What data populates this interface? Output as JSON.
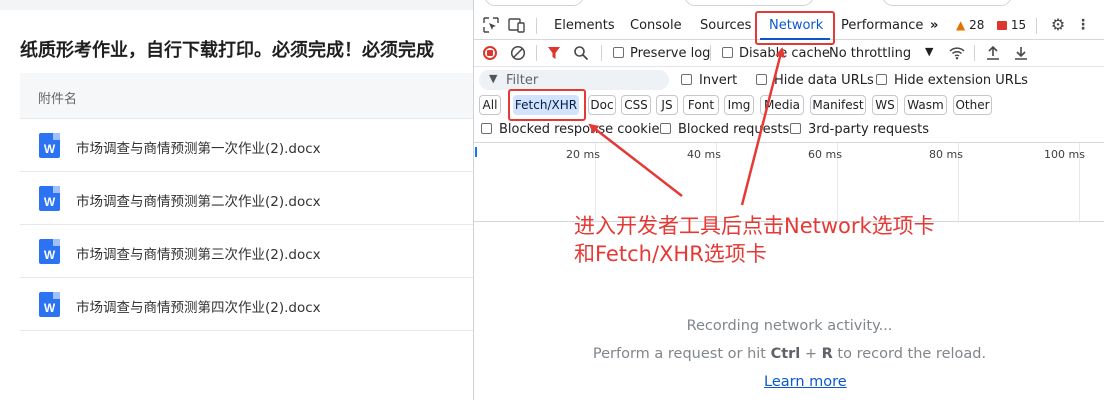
{
  "page": {
    "title": "纸质形考作业，自行下载打印。必须完成！必须完成",
    "table_header": "附件名",
    "files": [
      {
        "icon": "word-doc-icon",
        "icon_letter": "W",
        "name": "市场调查与商情预测第一次作业(2).docx"
      },
      {
        "icon": "word-doc-icon",
        "icon_letter": "W",
        "name": "市场调查与商情预测第二次作业(2).docx"
      },
      {
        "icon": "word-doc-icon",
        "icon_letter": "W",
        "name": "市场调查与商情预测第三次作业(2).docx"
      },
      {
        "icon": "word-doc-icon",
        "icon_letter": "W",
        "name": "市场调查与商情预测第四次作业(2).docx"
      }
    ]
  },
  "devtools": {
    "tabs": [
      "Elements",
      "Console",
      "Sources",
      "Network",
      "Performance"
    ],
    "active_tab": "Network",
    "more_tabs_glyph": "»",
    "warnings_count": "28",
    "errors_count": "15",
    "toolbar": {
      "preserve_log": "Preserve log",
      "disable_cache": "Disable cache",
      "throttling": "No throttling"
    },
    "filter": {
      "placeholder": "Filter",
      "invert": "Invert",
      "hide_data_urls": "Hide data URLs",
      "hide_extension_urls": "Hide extension URLs"
    },
    "type_chips": [
      "All",
      "Fetch/XHR",
      "Doc",
      "CSS",
      "JS",
      "Font",
      "Img",
      "Media",
      "Manifest",
      "WS",
      "Wasm",
      "Other"
    ],
    "active_chip": "Fetch/XHR",
    "options": {
      "blocked_cookies": "Blocked response cookies",
      "blocked_requests": "Blocked requests",
      "third_party": "3rd-party requests"
    },
    "timeline_ticks": [
      "20 ms",
      "40 ms",
      "60 ms",
      "80 ms",
      "100 ms"
    ],
    "empty_state": {
      "line1": "Recording network activity...",
      "line2_a": "Perform a request or hit ",
      "line2_key1": "Ctrl",
      "line2_plus": " + ",
      "line2_key2": "R",
      "line2_b": " to record the reload.",
      "learn_more": "Learn more"
    }
  },
  "annotation": {
    "color": "#e53935",
    "line1": "进入开发者工具后点击Network选项卡",
    "line2": "和Fetch/XHR选项卡"
  }
}
